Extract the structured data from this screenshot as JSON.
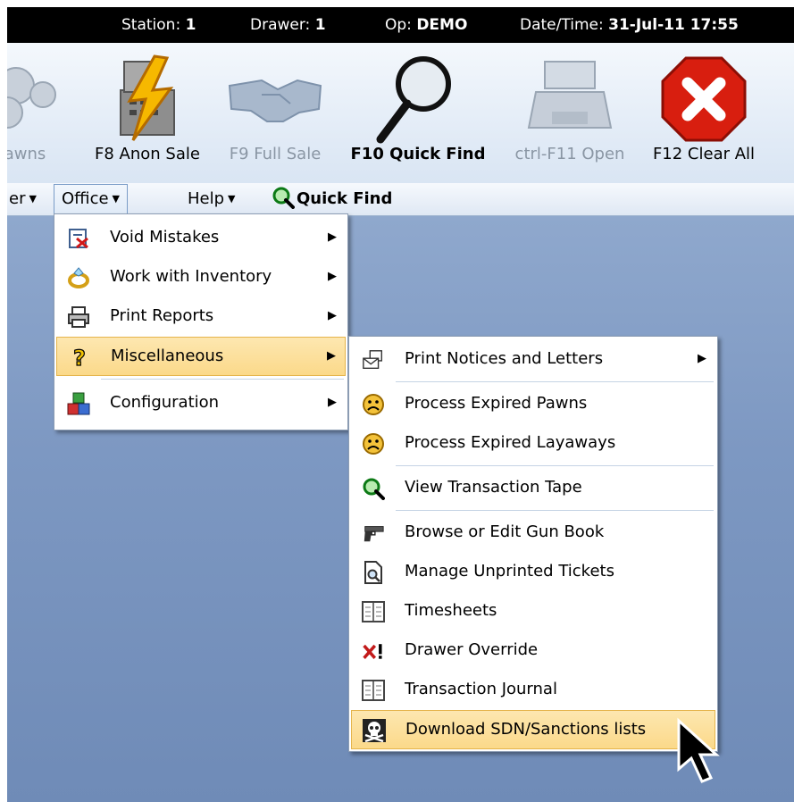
{
  "status_bar": {
    "station_label": "Station:",
    "station_value": "1",
    "drawer_label": "Drawer:",
    "drawer_value": "1",
    "op_label": "Op:",
    "op_value": "DEMO",
    "datetime_label": "Date/Time:",
    "datetime_value": "31-Jul-11 17:55"
  },
  "toolbar": {
    "buttons": [
      {
        "label": "Pawns",
        "icon": "scale-icon",
        "enabled": false
      },
      {
        "label": "F8 Anon Sale",
        "icon": "cash-register-lightning-icon",
        "enabled": true
      },
      {
        "label": "F9 Full Sale",
        "icon": "handshake-icon",
        "enabled": false
      },
      {
        "label": "F10 Quick Find",
        "icon": "magnifier-icon",
        "enabled": true
      },
      {
        "label": "ctrl-F11 Open",
        "icon": "cash-drawer-icon",
        "enabled": false
      },
      {
        "label": "F12 Clear All",
        "icon": "red-x-icon",
        "enabled": true
      }
    ]
  },
  "menubar": {
    "items": [
      "er",
      "Office",
      "Help",
      "Quick Find"
    ]
  },
  "office_menu": {
    "items": [
      {
        "label": "Void Mistakes",
        "icon": "void-icon"
      },
      {
        "label": "Work with Inventory",
        "icon": "ring-icon"
      },
      {
        "label": "Print Reports",
        "icon": "printer-icon"
      },
      {
        "label": "Miscellaneous",
        "icon": "question-icon",
        "highlighted": true
      },
      {
        "label": "Configuration",
        "icon": "blocks-icon"
      }
    ]
  },
  "misc_menu": {
    "items": [
      {
        "label": "Print Notices and Letters",
        "icon": "envelope-icon",
        "submenu": true
      },
      {
        "label": "Process Expired Pawns",
        "icon": "sad-face-icon"
      },
      {
        "label": "Process Expired Layaways",
        "icon": "sad-face-icon"
      },
      {
        "label": "View Transaction Tape",
        "icon": "green-magnifier-icon"
      },
      {
        "label": "Browse or Edit Gun Book",
        "icon": "gun-icon"
      },
      {
        "label": "Manage Unprinted Tickets",
        "icon": "document-search-icon"
      },
      {
        "label": "Timesheets",
        "icon": "ledger-icon"
      },
      {
        "label": "Drawer Override",
        "icon": "x-exclamation-icon"
      },
      {
        "label": "Transaction Journal",
        "icon": "ledger-icon"
      },
      {
        "label": "Download SDN/Sanctions lists",
        "icon": "skull-icon",
        "highlighted": true
      }
    ]
  },
  "colors": {
    "menu_highlight": "#fbd98a",
    "desktop_bg": "#7d98c2",
    "status_bar_bg": "#000000"
  }
}
